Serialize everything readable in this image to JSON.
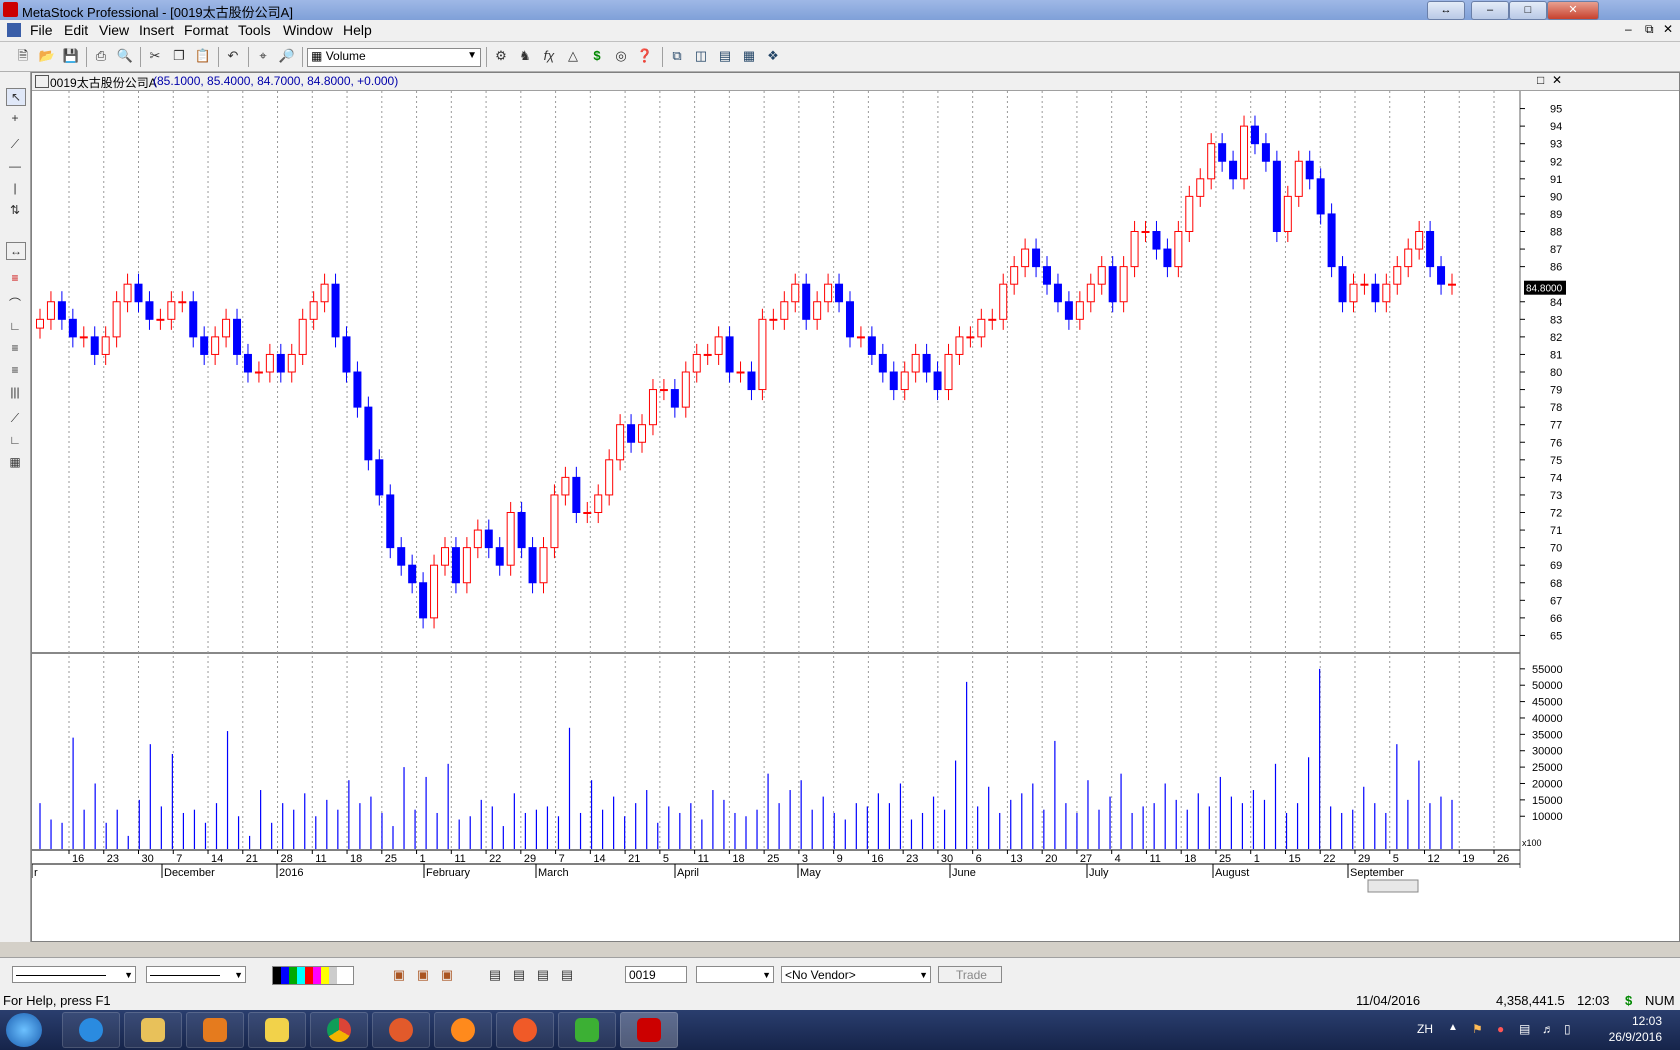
{
  "window": {
    "title": "MetaStock Professional - [0019太古股份公司A]",
    "title_bg": "#8aa9df"
  },
  "menu": [
    "File",
    "Edit",
    "View",
    "Insert",
    "Format",
    "Tools",
    "Window",
    "Help"
  ],
  "toolbar": {
    "indicator_combo": "Volume"
  },
  "chart": {
    "header": "0019太古股份公司A",
    "ohlc": "(85.1000, 85.4000, 84.7000, 84.8000, +0.000)",
    "last_price": "84.8000",
    "price_ticks": [
      "95",
      "94",
      "93",
      "92",
      "91",
      "90",
      "89",
      "88",
      "87",
      "86",
      "84",
      "83",
      "82",
      "81",
      "80",
      "79",
      "78",
      "77",
      "76",
      "75",
      "74",
      "73",
      "72",
      "71",
      "70",
      "69",
      "68",
      "67",
      "66",
      "65"
    ],
    "volume_ticks": [
      "55000",
      "50000",
      "45000",
      "40000",
      "35000",
      "30000",
      "25000",
      "20000",
      "15000",
      "10000"
    ],
    "volume_unit": "x100",
    "date_ticks": [
      "16",
      "23",
      "30",
      "7",
      "14",
      "21",
      "28",
      "11",
      "18",
      "25",
      "1",
      "11",
      "22",
      "29",
      "7",
      "14",
      "21",
      "5",
      "11",
      "18",
      "25",
      "3",
      "9",
      "16",
      "23",
      "30",
      "6",
      "13",
      "20",
      "27",
      "4",
      "11",
      "18",
      "25",
      "1",
      "15",
      "22",
      "29",
      "5",
      "12",
      "19",
      "26"
    ],
    "month_labels": [
      "r",
      "December",
      "2016",
      "February",
      "March",
      "April",
      "May",
      "June",
      "July",
      "August",
      "September"
    ],
    "up_color": "#ff0000",
    "down_color": "#0000ff"
  },
  "chart_data": {
    "type": "bar",
    "title": "0019太古股份公司A",
    "ylim": [
      64,
      96
    ],
    "volume_ylim": [
      0,
      58000
    ],
    "candles_close": [
      83,
      84,
      83,
      82,
      82,
      81,
      82,
      84,
      85,
      84,
      83,
      83,
      84,
      84,
      82,
      81,
      82,
      83,
      81,
      80,
      80,
      81,
      80,
      81,
      83,
      84,
      85,
      82,
      80,
      78,
      75,
      73,
      70,
      69,
      68,
      66,
      69,
      70,
      68,
      70,
      71,
      70,
      69,
      72,
      70,
      68,
      70,
      73,
      74,
      72,
      72,
      73,
      75,
      77,
      76,
      77,
      79,
      79,
      78,
      80,
      81,
      81,
      82,
      80,
      80,
      79,
      83,
      83,
      84,
      85,
      83,
      84,
      85,
      84,
      82,
      82,
      81,
      80,
      79,
      80,
      81,
      80,
      79,
      81,
      82,
      82,
      83,
      83,
      85,
      86,
      87,
      86,
      85,
      84,
      83,
      84,
      85,
      86,
      84,
      86,
      88,
      88,
      87,
      86,
      88,
      90,
      91,
      93,
      92,
      91,
      94,
      93,
      92,
      88,
      90,
      92,
      91,
      89,
      86,
      84,
      85,
      85,
      84,
      85,
      86,
      87,
      88,
      86,
      85,
      85
    ],
    "volume": [
      14000,
      9000,
      8000,
      34000,
      12000,
      20000,
      8000,
      12000,
      4000,
      15000,
      32000,
      13000,
      29000,
      11000,
      12000,
      8000,
      14000,
      36000,
      10000,
      4000,
      18000,
      8000,
      14000,
      12000,
      17000,
      10000,
      15000,
      12000,
      21000,
      14000,
      16000,
      11000,
      7000,
      25000,
      12000,
      22000,
      11000,
      26000,
      9000,
      10000,
      15000,
      13000,
      7000,
      17000,
      11000,
      12000,
      13000,
      10000,
      37000,
      11000,
      21000,
      12000,
      16000,
      10000,
      14000,
      18000,
      8000,
      13000,
      11000,
      14000,
      9000,
      18000,
      15000,
      11000,
      10000,
      12000,
      23000,
      14000,
      18000,
      21000,
      12000,
      16000,
      11000,
      9000,
      14000,
      13000,
      17000,
      14000,
      20000,
      9000,
      11000,
      16000,
      12000,
      27000,
      51000,
      13000,
      19000,
      11000,
      15000,
      17000,
      20000,
      12000,
      33000,
      14000,
      11000,
      21000,
      12000,
      16000,
      23000,
      11000,
      13000,
      14000,
      20000,
      15000,
      12000,
      17000,
      13000,
      22000,
      16000,
      14000,
      18000,
      15000,
      26000,
      11000,
      14000,
      28000,
      55000,
      13000,
      11000,
      12000,
      19000,
      14000,
      11000,
      32000,
      15000,
      27000,
      14000,
      16000,
      15000
    ],
    "volume_unit": "x100"
  },
  "bottom": {
    "symbol": "0019",
    "vendor": "<No Vendor>",
    "trade_label": "Trade"
  },
  "status": {
    "help": "For Help, press F1",
    "date": "11/04/2016",
    "value": "4,358,441.5",
    "time": "12:03",
    "currency": "$",
    "num": "NUM"
  },
  "taskbar": {
    "lang": "ZH",
    "time": "12:03",
    "date": "26/9/2016"
  }
}
